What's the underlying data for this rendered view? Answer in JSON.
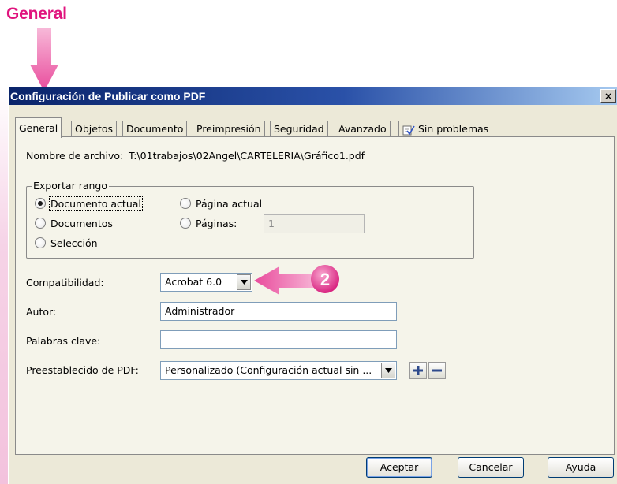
{
  "annotation": {
    "title": "General",
    "badge": "2",
    "accent": "#e0147e"
  },
  "window": {
    "title": "Configuración de Publicar como PDF",
    "close_glyph": "×"
  },
  "tabs": [
    {
      "label": "General",
      "active": true
    },
    {
      "label": "Objetos",
      "active": false
    },
    {
      "label": "Documento",
      "active": false
    },
    {
      "label": "Preimpresión",
      "active": false
    },
    {
      "label": "Seguridad",
      "active": false
    },
    {
      "label": "Avanzado",
      "active": false
    },
    {
      "label": "Sin problemas",
      "active": false,
      "icon": "check-document-icon"
    }
  ],
  "filename": {
    "label": "Nombre de archivo:",
    "value": "T:\\01trabajos\\02Angel\\CARTELERIA\\Gráfico1.pdf"
  },
  "export_range": {
    "title": "Exportar rango",
    "options": {
      "current_document": "Documento actual",
      "documents": "Documentos",
      "selection": "Selección",
      "current_page": "Página actual",
      "pages": "Páginas:"
    },
    "selected": "current_document",
    "pages_value": "1"
  },
  "compatibility": {
    "label": "Compatibilidad:",
    "value": "Acrobat 6.0"
  },
  "author": {
    "label": "Autor:",
    "value": "Administrador"
  },
  "keywords": {
    "label": "Palabras clave:",
    "value": ""
  },
  "preset": {
    "label": "Preestablecido de PDF:",
    "value": "Personalizado (Configuración actual sin ..."
  },
  "buttons": {
    "ok": "Aceptar",
    "cancel": "Cancelar",
    "help": "Ayuda"
  }
}
